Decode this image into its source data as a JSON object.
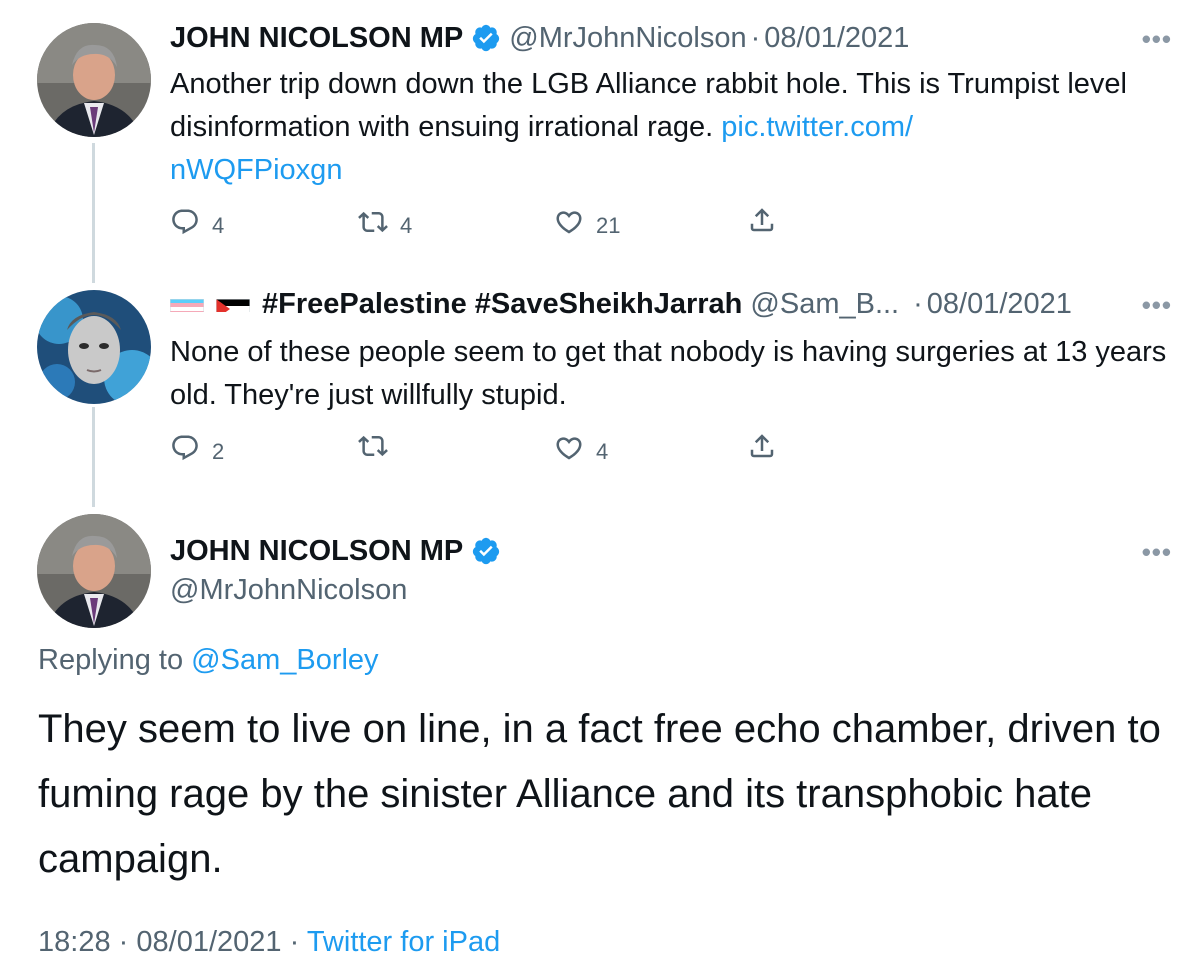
{
  "tweet1": {
    "name": "JOHN NICOLSON MP",
    "handle": "@MrJohnNicolson",
    "separator": "·",
    "date": "08/01/2021",
    "more": "•••",
    "text": "Another trip down down the LGB Alliance rabbit hole. This is Trumpist level disinformation with ensuing irrational rage.",
    "link": "pic.twitter.com/nWQFPioxgn",
    "replies": "4",
    "retweets": "4",
    "likes": "21"
  },
  "tweet2": {
    "name": "#FreePalestine #SaveSheikhJarrah",
    "handle": "@Sam_B...",
    "separator": "·",
    "date": "08/01/2021",
    "more": "•••",
    "text": "None of these people seem to get that nobody is having surgeries at 13 years old. They're just willfully stupid.",
    "replies": "2",
    "retweets": "",
    "likes": "4"
  },
  "main": {
    "name": "JOHN NICOLSON MP",
    "handle": "@MrJohnNicolson",
    "more": "•••",
    "replying_prefix": "Replying to",
    "replying_handle": "@Sam_Borley",
    "text": "They seem to live on line, in a fact free echo chamber, driven to fuming rage by the sinister Alliance and its transphobic hate campaign.",
    "time": "18:28",
    "separator": "·",
    "date": "08/01/2021",
    "source": "Twitter for iPad"
  },
  "icons": [
    "verified-badge-icon",
    "reply-icon",
    "retweet-icon",
    "like-icon",
    "share-icon",
    "trans-flag-icon",
    "palestine-flag-icon",
    "more-icon"
  ],
  "colors": {
    "link": "#1d9bf0",
    "secondary_text": "#536471",
    "primary_text": "#0f1419",
    "thread_line": "#cfd9de",
    "verified": "#1d9bf0"
  }
}
